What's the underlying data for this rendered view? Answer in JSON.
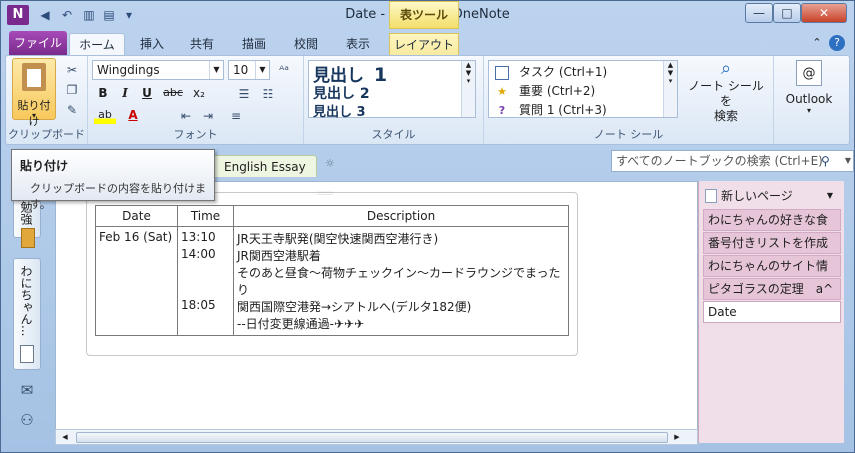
{
  "window": {
    "title": "Date  -  Microsoft OneNote",
    "context_tab_group": "表ツール",
    "app_icon": "onenote-logo",
    "controls": {
      "minimize": "—",
      "maximize": "□",
      "close": "✕"
    }
  },
  "qat": {
    "back": "◀",
    "undo": "↶",
    "view1": "▥",
    "view2": "▤",
    "customize": "▾"
  },
  "tabs": {
    "file": "ファイル",
    "items": [
      "ホーム",
      "挿入",
      "共有",
      "描画",
      "校閲",
      "表示",
      "レイアウト"
    ],
    "active": "ホーム",
    "context": "レイアウト",
    "collapse": "⌃",
    "help": "?"
  },
  "clipboard": {
    "paste_label": "貼り付け",
    "paste_dropdown": "▾",
    "group_label": "クリップボード"
  },
  "font": {
    "name": "Wingdings",
    "size": "10",
    "bold": "B",
    "italic": "I",
    "underline": "U",
    "strikethrough": "abc",
    "subscript": "x₂",
    "highlight": "ab",
    "font_color": "A",
    "group_label": "フォント"
  },
  "styles": {
    "heading1": "見出し",
    "heading1_num": "1",
    "heading2": "見出し 2",
    "heading3": "見出し 3",
    "group_label": "スタイル"
  },
  "tags": {
    "todo": "タスク (Ctrl+1)",
    "important": "重要 (Ctrl+2)",
    "question": "質問 1 (Ctrl+3)",
    "find_tags": "ノート シールを\n検索",
    "group_label": "ノート シール"
  },
  "outlook": {
    "label": "Outlook"
  },
  "tooltip": {
    "title": "貼り付け",
    "body": "クリップボードの内容を貼り付けます。"
  },
  "sections": {
    "active": "English Essay",
    "add": "☼"
  },
  "search": {
    "placeholder": "すべてのノートブックの検索 (Ctrl+E)",
    "icon": "⚲"
  },
  "nav": {
    "notebook1": "勉強",
    "notebook2": "わにちゃん..."
  },
  "table": {
    "headers": [
      "Date",
      "Time",
      "Description"
    ],
    "date": "Feb 16 (Sat)",
    "times": [
      "13:10",
      "14:00",
      "",
      "",
      "18:05",
      "",
      ""
    ],
    "descriptions": [
      "JR天王寺駅発(関空快速関西空港行き)",
      "JR関西空港駅着",
      "そのあと昼食～荷物チェックイン～カードラウンジでまった",
      "り",
      "関西国際空港発→シアトルへ(デルタ182便)",
      "--日付変更線通過-✈✈✈"
    ]
  },
  "pages": {
    "new_page": "新しいページ",
    "items": [
      "わにちゃんの好きな食",
      "番号付きリストを作成",
      "わにちゃんのサイト情",
      "ピタゴラスの定理　a^",
      "Date"
    ]
  },
  "colors": {
    "file_tab": "#7a2a8c",
    "pages_pane": "#f0dfe9",
    "context_tab": "#f2df6a"
  }
}
